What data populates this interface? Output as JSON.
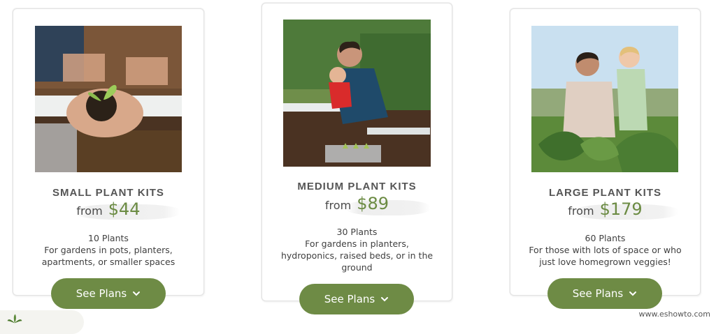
{
  "cards": [
    {
      "title": "SMALL PLANT KITS",
      "from": "from",
      "price": "$44",
      "count": "10 Plants",
      "description": "For gardens in pots, planters, apartments, or smaller spaces",
      "button": "See Plans",
      "image_alt": "hands-holding-seedling-photo"
    },
    {
      "title": "MEDIUM PLANT KITS",
      "from": "from",
      "price": "$89",
      "count": "30 Plants",
      "description": "For gardens in planters, hydroponics, raised beds, or in the ground",
      "button": "See Plans",
      "image_alt": "father-and-child-planting-photo"
    },
    {
      "title": "LARGE PLANT KITS",
      "from": "from",
      "price": "$179",
      "count": "60 Plants",
      "description": "For those with lots of space or who just love homegrown veggies!",
      "button": "See Plans",
      "image_alt": "father-and-son-in-garden-photo"
    }
  ],
  "watermark": "www.eshowto.com",
  "colors": {
    "accent_green": "#6e8b45",
    "price_green": "#6b8b43",
    "card_border": "#e3e3e3"
  },
  "icons": [
    "chevron-down-icon",
    "leaf-logo-icon"
  ]
}
